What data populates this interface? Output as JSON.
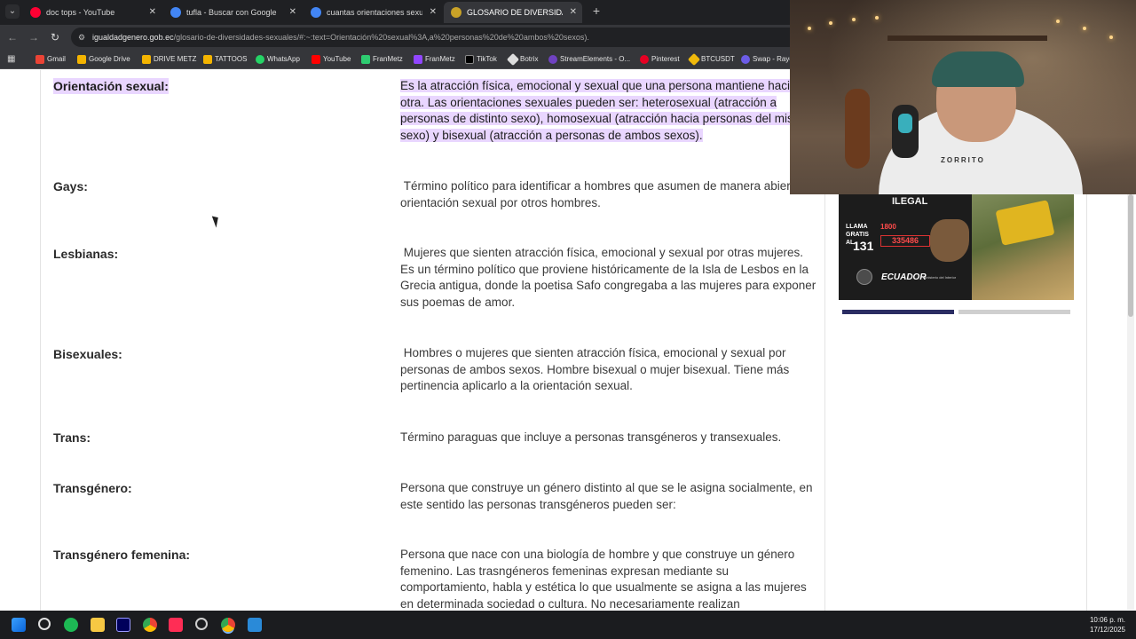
{
  "browser": {
    "tabs": [
      {
        "label": "doc tops - YouTube",
        "active": false,
        "favicon_color": "#ff0033"
      },
      {
        "label": "tufla - Buscar con Google",
        "active": false,
        "favicon_color": "#4285f4"
      },
      {
        "label": "cuantas orientaciones sexuales",
        "active": false,
        "favicon_color": "#4285f4"
      },
      {
        "label": "GLOSARIO DE DIVERSIDADES S",
        "active": true,
        "favicon_color": "#c9a227"
      }
    ],
    "new_tab_label": "+",
    "url_domain": "igualdadgenero.gob.ec",
    "url_path": "/glosario-de-diversidades-sexuales/#:~:text=Orientación%20sexual%3A,a%20personas%20de%20ambos%20sexos).",
    "bookmarks": [
      {
        "label": "Gmail",
        "color": "#ea4335"
      },
      {
        "label": "Google Drive",
        "color": "#f4b400"
      },
      {
        "label": "DRIVE METZ",
        "color": "#f4b400"
      },
      {
        "label": "TATTOOS",
        "color": "#f4b400"
      },
      {
        "label": "WhatsApp",
        "color": "#25d366"
      },
      {
        "label": "YouTube",
        "color": "#ff0000"
      },
      {
        "label": "FranMetz",
        "color": "#2ecc71"
      },
      {
        "label": "FranMetz",
        "color": "#9146ff"
      },
      {
        "label": "TikTok",
        "color": "#000000"
      },
      {
        "label": "Botrix",
        "color": "#dddddd"
      },
      {
        "label": "StreamElements - O...",
        "color": "#6f42c1"
      },
      {
        "label": "Pinterest",
        "color": "#e60023"
      },
      {
        "label": "BTCUSDT",
        "color": "#f0b90b"
      },
      {
        "label": "Swap - Rayd",
        "color": "#6c5ce7"
      }
    ]
  },
  "glossary": [
    {
      "term": "Orientación sexual:",
      "definition": "Es la atracción física, emocional y sexual que una persona mantiene hacia otra. Las orientaciones sexuales pueden ser: heterosexual (atracción a personas de distinto sexo), homosexual (atracción hacia personas del mismo sexo) y bisexual (atracción a personas de ambos sexos).",
      "highlighted": true
    },
    {
      "term": "Gays:",
      "definition": " Término político para identificar a hombres que asumen de manera abierta su orientación sexual por otros hombres."
    },
    {
      "term": "Lesbianas:",
      "definition": " Mujeres que sienten atracción física, emocional y sexual por otras mujeres. Es un término político que proviene históricamente de la Isla de Lesbos en la Grecia antigua, donde la poetisa Safo congregaba a las mujeres para exponer sus poemas de amor."
    },
    {
      "term": "Bisexuales:",
      "definition": " Hombres o mujeres que sienten atracción física, emocional y sexual por personas de ambos sexos. Hombre bisexual o mujer bisexual. Tiene más pertinencia aplicarlo a la orientación sexual."
    },
    {
      "term": "Trans:",
      "definition": "Término paraguas que incluye a personas transgéneros y transexuales."
    },
    {
      "term": "Transgénero:",
      "definition": "Persona que construye un género distinto al que se le asigna socialmente, en este sentido las personas transgéneros pueden ser:"
    },
    {
      "term": "Transgénero femenina:",
      "definition": "Persona que nace con una biología de hombre y que construye un género femenino. Las trasngéneros femeninas expresan mediante su comportamiento, habla y estética lo que usualmente se asigna a las mujeres en determinada sociedad o cultura. No necesariamente realizan"
    }
  ],
  "ad": {
    "title_line1": "ILEGAL",
    "call_text": "LLAMA GRATIS AL",
    "call_number": "131",
    "phone": "1800",
    "phone_digits": "335486",
    "brand": "ECUADOR",
    "ministry": "Ministerio del Interior"
  },
  "webcam": {
    "shirt_text": "ZORRITO"
  },
  "taskbar": {
    "time": "10:06 p. m.",
    "date": "17/12/2025"
  },
  "colors": {
    "highlight": "#e9d6ff",
    "slider_active": "#2b2d63",
    "slider_inactive": "#cfcfcf"
  }
}
